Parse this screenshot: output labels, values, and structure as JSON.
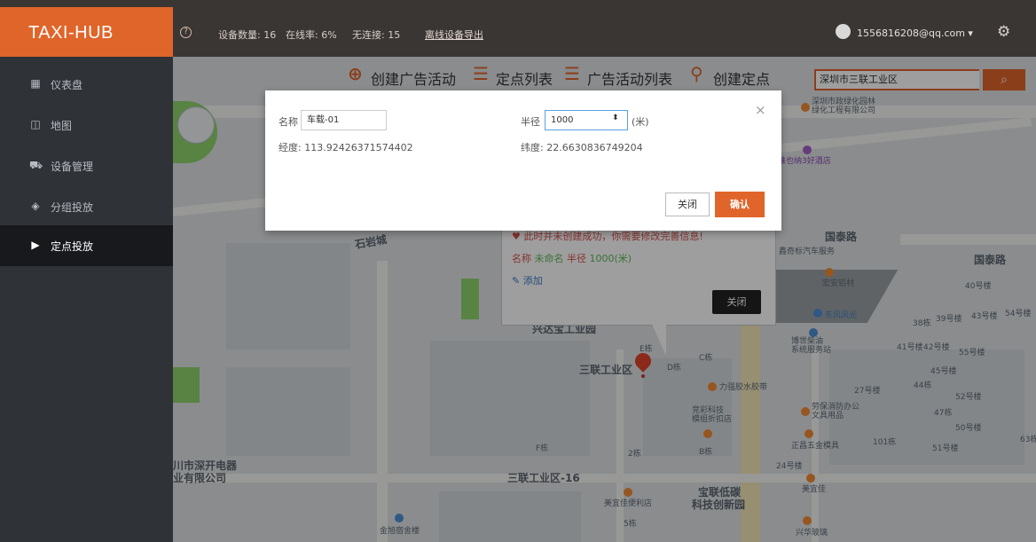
{
  "brand": "TAXI-HUB",
  "header": {
    "help_icon": "question-circle-icon",
    "device_count": "设备数量: 16",
    "online_rate": "在线率: 6%",
    "no_connection": "无连接: 15",
    "export_link": "离线设备导出",
    "user_email": "1556816208@qq.com ▾",
    "settings_icon": "gear-icon"
  },
  "sidebar": {
    "items": [
      {
        "label": "仪表盘",
        "icon": "dashboard-icon"
      },
      {
        "label": "地图",
        "icon": "map-icon"
      },
      {
        "label": "设备管理",
        "icon": "car-icon"
      },
      {
        "label": "分组投放",
        "icon": "group-icon"
      },
      {
        "label": "定点投放",
        "icon": "play-icon"
      }
    ],
    "active": "定点投放"
  },
  "toolbar": {
    "create_ad": "创建广告活动",
    "point_list": "定点列表",
    "ad_list": "广告活动列表",
    "create_point": "创建定点"
  },
  "search": {
    "value": "深圳市三联工业区",
    "icon": "search-icon"
  },
  "map_labels": {
    "road_1": "国泰路",
    "road_2": "国泰路",
    "road_3": "石岩城",
    "zone_1": "兴达宝工业园",
    "zone_2": "三联工业区",
    "zone_3": "三联工业区-16",
    "zone_4": "宝联低碳",
    "zone_5": "科技创新园",
    "zone_6": "川市深开电器",
    "zone_7": "业有限公司",
    "poi_1": "深圳市政绿化园林\n绿化工程有限公司",
    "poi_2": "维也纳3好酒店",
    "poi_3": "鑫奇标汽车服务",
    "poi_4": "宏安铝材",
    "poi_5": "东风风光",
    "poi_6": "博世柴油\n系统服务站",
    "poi_7": "力强胶水胶带",
    "poi_8": "竞彩科技\n模组折扣店",
    "poi_9": "劳保消防办公\n文具用品",
    "poi_10": "正昌五金模具",
    "poi_11": "美宜佳",
    "poi_12": "金旭宿舍楼",
    "poi_13": "兴华玻璃",
    "poi_14": "美宜佳便利店",
    "bld_1": "40号楼",
    "bld_2": "39号楼",
    "bld_3": "43号楼",
    "bld_4": "54号楼",
    "bld_5": "38栋",
    "bld_6": "41号楼",
    "bld_7": "42号楼",
    "bld_8": "55号楼",
    "bld_9": "45号楼",
    "bld_10": "44栋",
    "bld_11": "52号楼",
    "bld_12": "27号楼",
    "bld_13": "47栋",
    "bld_14": "50号楼",
    "bld_15": "101栋",
    "bld_16": "51号楼",
    "bld_17": "63栋",
    "bld_18": "24号楼",
    "bld_19": "D栋",
    "bld_20": "C栋",
    "bld_21": "B栋",
    "bld_22": "F栋",
    "bld_23": "2栋",
    "bld_24": "5栋",
    "bld_25": "E栋"
  },
  "info_window": {
    "message": "♥ 此时并未创建成功，你需要修改完善信息!",
    "name_label": "名称",
    "name_value": "未命名",
    "radius_label": "半径",
    "radius_value": "1000(米)",
    "add_link": "添加",
    "close_button": "关闭"
  },
  "modal": {
    "name_label": "名称",
    "name_value": "车载-01",
    "radius_label": "半径",
    "radius_value": "1000",
    "radius_unit": "(米)",
    "longitude": "经度: 113.92426371574402",
    "latitude": "纬度: 22.6630836749204",
    "close_button": "关闭",
    "confirm_button": "确认"
  }
}
